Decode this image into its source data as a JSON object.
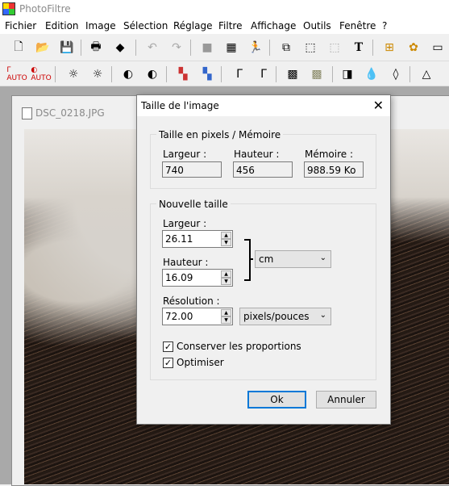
{
  "app": {
    "title": "PhotoFiltre"
  },
  "menu": [
    "Fichier",
    "Edition",
    "Image",
    "Sélection",
    "Réglage",
    "Filtre",
    "Affichage",
    "Outils",
    "Fenêtre",
    "?"
  ],
  "toolbar1_icons": [
    "new-icon",
    "open-icon",
    "save-icon",
    "print-icon",
    "scan-icon",
    "undo-icon",
    "redo-icon",
    "gray-square-icon",
    "palette-icon",
    "runner-icon",
    "copy-icon",
    "selection-icon",
    "text-icon",
    "tree-icon",
    "settings-icon",
    "window-icon"
  ],
  "toolbar2_icons": [
    "auto-levels-icon",
    "auto-contrast-icon",
    "brightness-minus-icon",
    "brightness-plus-icon",
    "contrast-minus-icon",
    "contrast-plus-icon",
    "saturation-minus-icon",
    "saturation-plus-icon",
    "gamma-minus-icon",
    "gamma-plus-icon",
    "texture-icon",
    "emboss-icon",
    "filter-icon",
    "drop-icon",
    "drop-outline-icon",
    "triangle-icon"
  ],
  "document": {
    "title": "DSC_0218.JPG"
  },
  "dialog": {
    "title": "Taille de l'image",
    "pixels_group": {
      "legend": "Taille en pixels / Mémoire",
      "width_label": "Largeur :",
      "height_label": "Hauteur :",
      "memory_label": "Mémoire :",
      "width_value": "740",
      "height_value": "456",
      "memory_value": "988.59 Ko"
    },
    "new_size_group": {
      "legend": "Nouvelle taille",
      "width_label": "Largeur :",
      "width_value": "26.11",
      "height_label": "Hauteur :",
      "height_value": "16.09",
      "unit": "cm",
      "resolution_label": "Résolution :",
      "resolution_value": "72.00",
      "resolution_unit": "pixels/pouces",
      "keep_proportions_label": "Conserver les proportions",
      "keep_proportions_checked": true,
      "optimize_label": "Optimiser",
      "optimize_checked": true
    },
    "ok_label": "Ok",
    "cancel_label": "Annuler"
  }
}
